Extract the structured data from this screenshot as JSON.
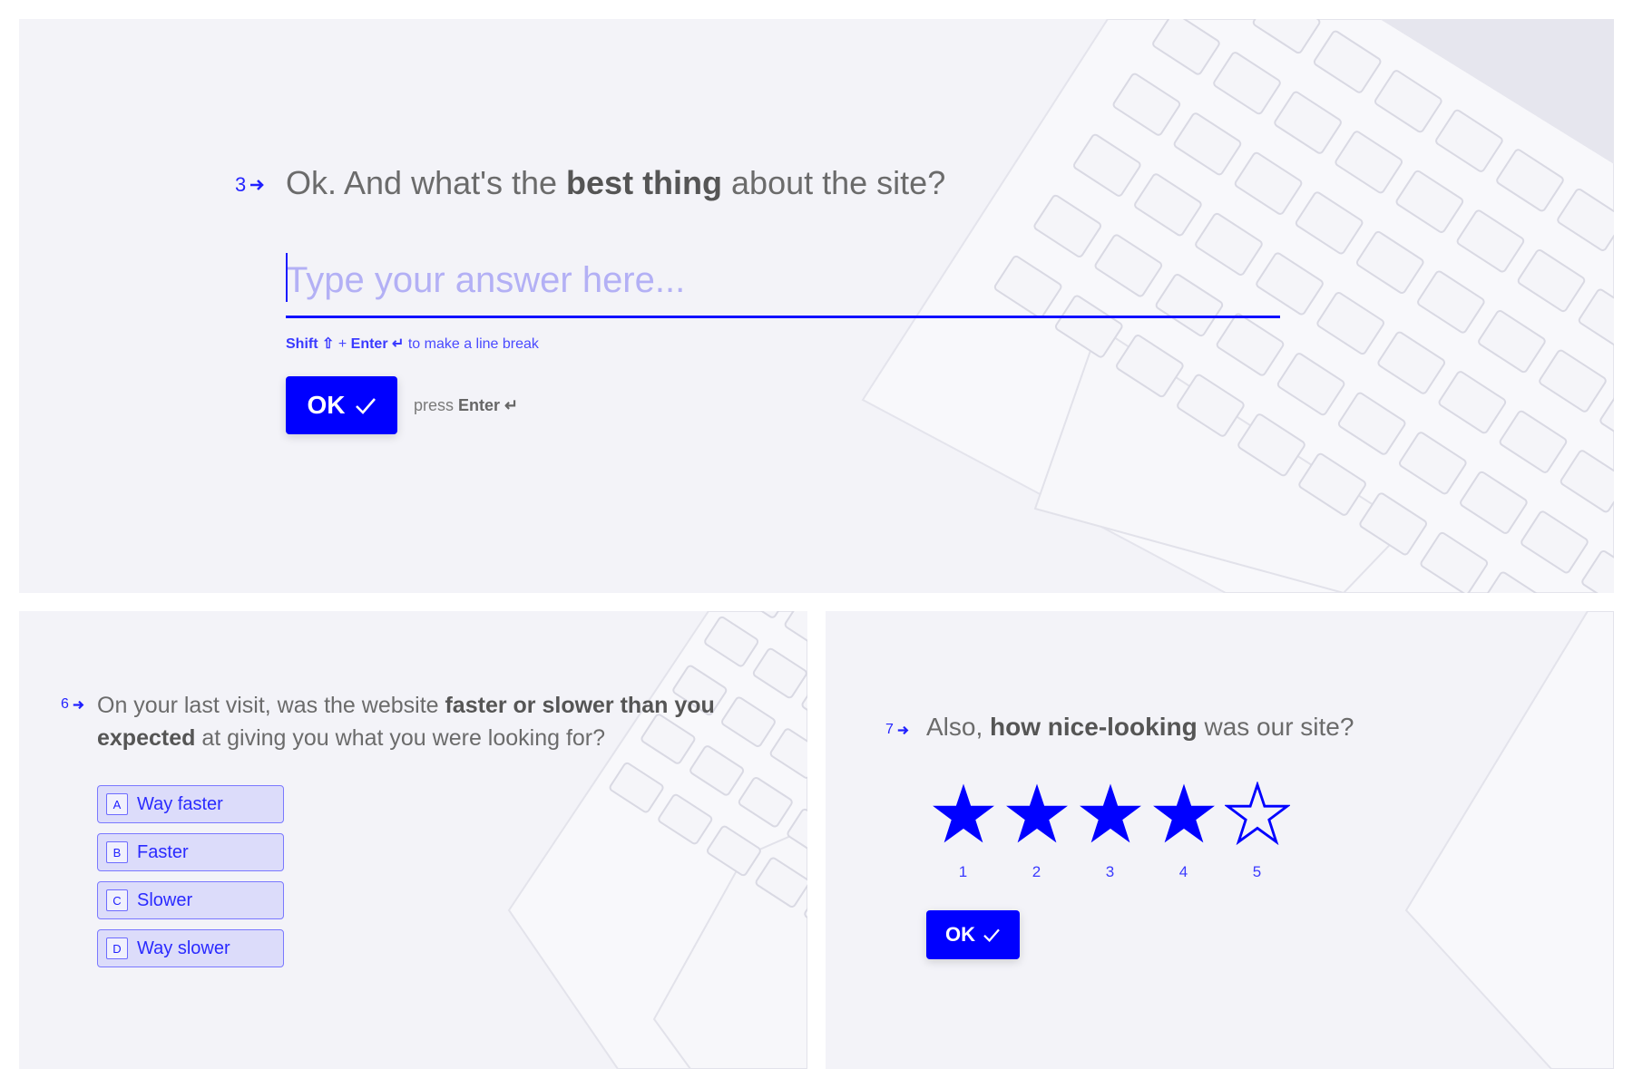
{
  "accent_color": "#0000ff",
  "question3": {
    "number": "3",
    "arrow_icon": "arrow-right-icon",
    "text_before": "Ok. And what's the ",
    "text_bold": "best thing",
    "text_after": " about the site?",
    "input_placeholder": "Type your answer here...",
    "input_value": "",
    "hint_shift": "Shift ⇧",
    "hint_plus": " + ",
    "hint_enter": "Enter ↵",
    "hint_rest": " to make a line break",
    "ok_label": "OK",
    "press_label": "press ",
    "press_key": "Enter ↵"
  },
  "question6": {
    "number": "6",
    "text_before": "On your last visit, was the website ",
    "text_bold": "faster or slower than you expected",
    "text_after": " at giving you what you were looking for?",
    "options": [
      {
        "key": "A",
        "label": "Way faster"
      },
      {
        "key": "B",
        "label": "Faster"
      },
      {
        "key": "C",
        "label": "Slower"
      },
      {
        "key": "D",
        "label": "Way slower"
      }
    ]
  },
  "question7": {
    "number": "7",
    "text_before": "Also, ",
    "text_bold": "how nice-looking",
    "text_after": " was our site?",
    "rating": {
      "value": 4,
      "max": 5,
      "labels": [
        "1",
        "2",
        "3",
        "4",
        "5"
      ]
    },
    "ok_label": "OK"
  }
}
